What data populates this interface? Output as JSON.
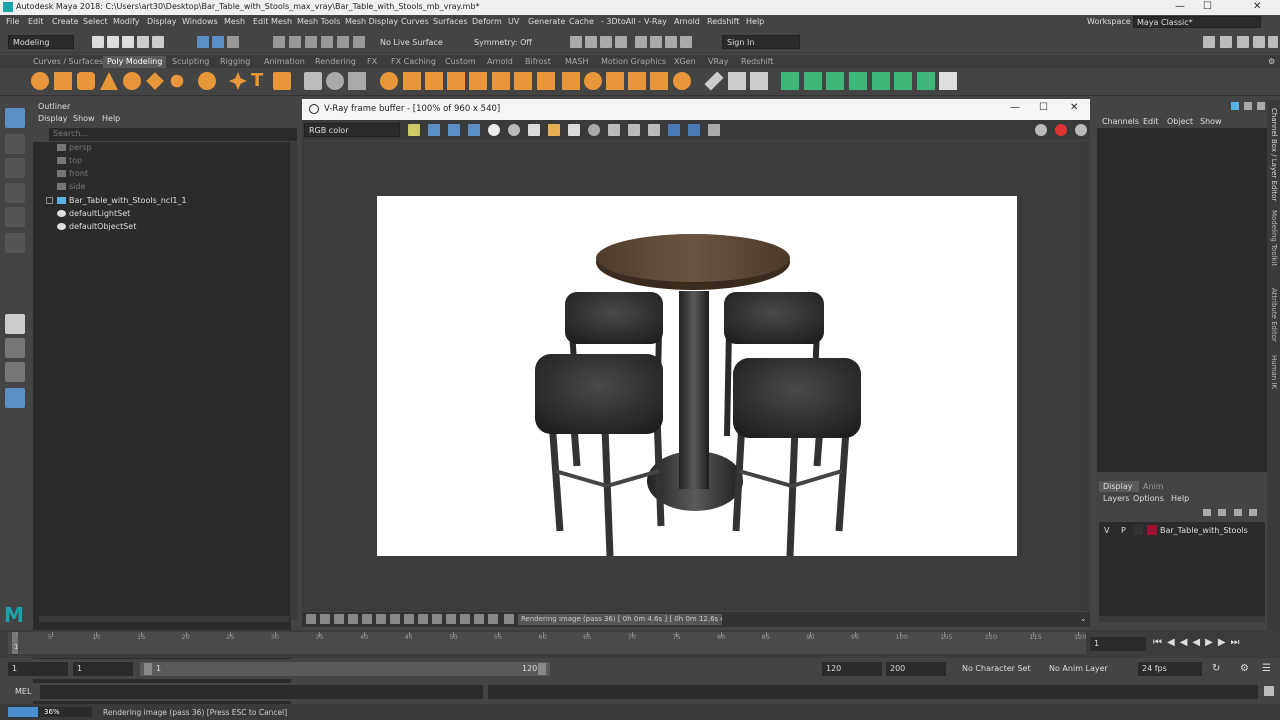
{
  "window": {
    "title": "Autodesk Maya 2018: C:\\Users\\art30\\Desktop\\Bar_Table_with_Stools_max_vray\\Bar_Table_with_Stools_mb_vray.mb*"
  },
  "menubar": {
    "items": [
      "File",
      "Edit",
      "Create",
      "Select",
      "Modify",
      "Display",
      "Windows",
      "Mesh",
      "Edit Mesh",
      "Mesh Tools",
      "Mesh Display",
      "Curves",
      "Surfaces",
      "Deform",
      "UV",
      "Generate",
      "Cache",
      "- 3DtoAll -",
      "V-Ray",
      "Arnold",
      "Redshift",
      "Help"
    ],
    "workspace_label": "Workspace :",
    "workspace_value": "Maya Classic*"
  },
  "statusline": {
    "mode": "Modeling",
    "live_surface": "No Live Surface",
    "symmetry": "Symmetry: Off",
    "sign_in": "Sign In"
  },
  "shelf": {
    "tabs": [
      "Curves / Surfaces",
      "Poly Modeling",
      "Sculpting",
      "Rigging",
      "Animation",
      "Rendering",
      "FX",
      "FX Caching",
      "Custom",
      "Arnold",
      "Bifrost",
      "MASH",
      "Motion Graphics",
      "XGen",
      "VRay",
      "Redshift"
    ],
    "active_tab": "Poly Modeling"
  },
  "outliner": {
    "title": "Outliner",
    "menu": [
      "Display",
      "Show",
      "Help"
    ],
    "search_placeholder": "Search...",
    "items": [
      {
        "label": "persp",
        "dim": true
      },
      {
        "label": "top",
        "dim": true
      },
      {
        "label": "front",
        "dim": true
      },
      {
        "label": "side",
        "dim": true
      },
      {
        "label": "Bar_Table_with_Stools_ncl1_1",
        "dim": false
      },
      {
        "label": "defaultLightSet",
        "dim": false
      },
      {
        "label": "defaultObjectSet",
        "dim": false
      }
    ]
  },
  "vfb": {
    "title": "V-Ray frame buffer - [100% of 960 x 540]",
    "channel": "RGB color",
    "status": "Rendering image (pass 36) [ 0h  0m  4.6s ] [ 0h  0m  12.6s est ]"
  },
  "channels": {
    "menu": [
      "Channels",
      "Edit",
      "Object",
      "Show"
    ],
    "tabs": [
      "Display",
      "Anim"
    ],
    "layer_menu": [
      "Layers",
      "Options",
      "Help"
    ],
    "layer": {
      "v": "V",
      "p": "P",
      "name": "Bar_Table_with_Stools",
      "color": "#a0102e"
    }
  },
  "sidetabs": [
    "Channel Box / Layer Editor",
    "Modeling Toolkit",
    "Attribute Editor",
    "Human IK"
  ],
  "timeline": {
    "ticks": [
      1,
      5,
      10,
      15,
      20,
      25,
      30,
      35,
      40,
      45,
      50,
      55,
      60,
      65,
      70,
      75,
      80,
      85,
      90,
      95,
      100,
      105,
      110,
      115,
      120
    ],
    "current_frame": "1"
  },
  "range": {
    "start": "1",
    "start2": "1",
    "slider_start": "1",
    "slider_end": "120",
    "end": "120",
    "end2": "200",
    "character_set": "No Character Set",
    "anim_layer": "No Anim Layer",
    "fps": "24 fps"
  },
  "mel": {
    "label": "MEL"
  },
  "helpline": {
    "progress_value": 36,
    "progress_text": "36%",
    "message": "Rendering image (pass 36) [Press ESC to Cancel]"
  },
  "colors": {
    "accent_orange": "#e8963a",
    "accent_green": "#3db87a",
    "select_blue": "#5a8fc8",
    "render_bg": "#ffffff"
  }
}
